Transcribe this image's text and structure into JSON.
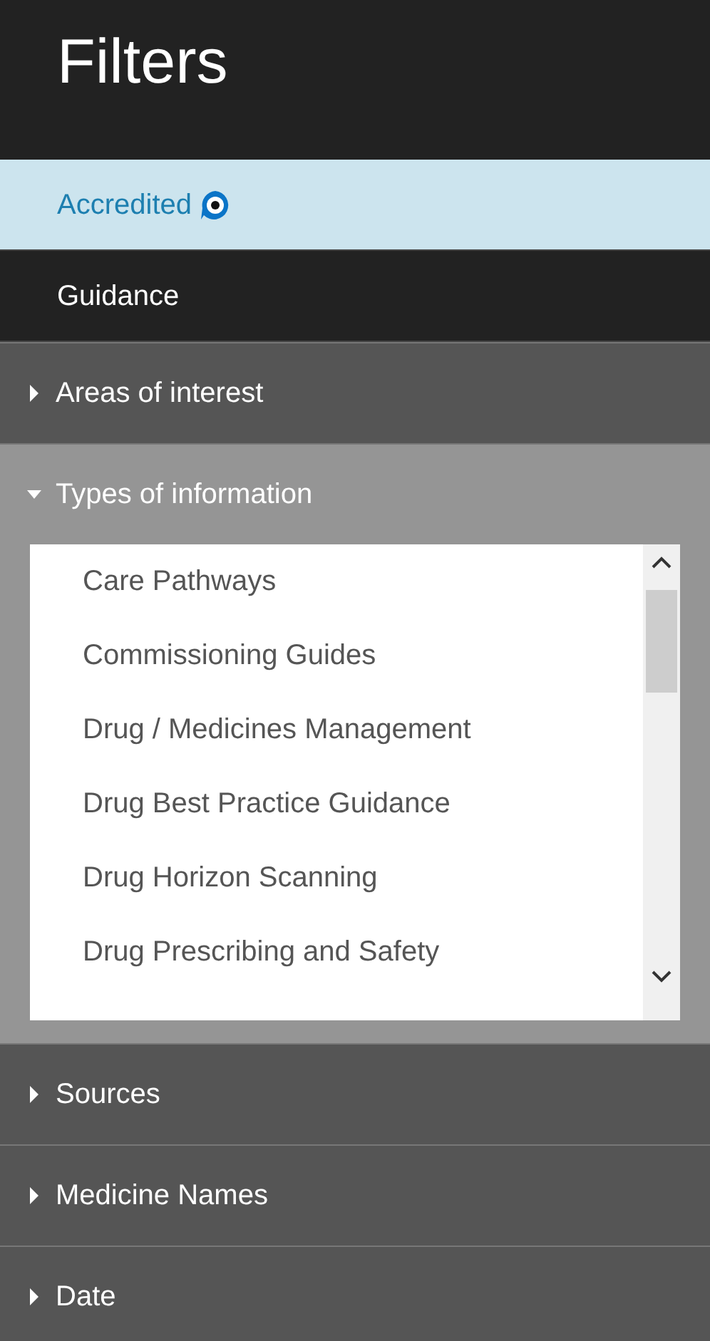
{
  "title": "Filters",
  "filters": [
    {
      "kind": "toggle",
      "label": "Accredited",
      "selected": true
    },
    {
      "kind": "toggle",
      "label": "Guidance",
      "selected": false
    },
    {
      "kind": "group",
      "label": "Areas of interest",
      "expanded": false
    },
    {
      "kind": "group",
      "label": "Types of information",
      "expanded": true,
      "options": [
        "Care Pathways",
        "Commissioning Guides",
        "Drug / Medicines Management",
        "Drug Best Practice Guidance",
        "Drug Horizon Scanning",
        "Drug Prescribing and Safety"
      ]
    },
    {
      "kind": "group",
      "label": "Sources",
      "expanded": false
    },
    {
      "kind": "group",
      "label": "Medicine Names",
      "expanded": false
    },
    {
      "kind": "group",
      "label": "Date",
      "expanded": false
    }
  ]
}
